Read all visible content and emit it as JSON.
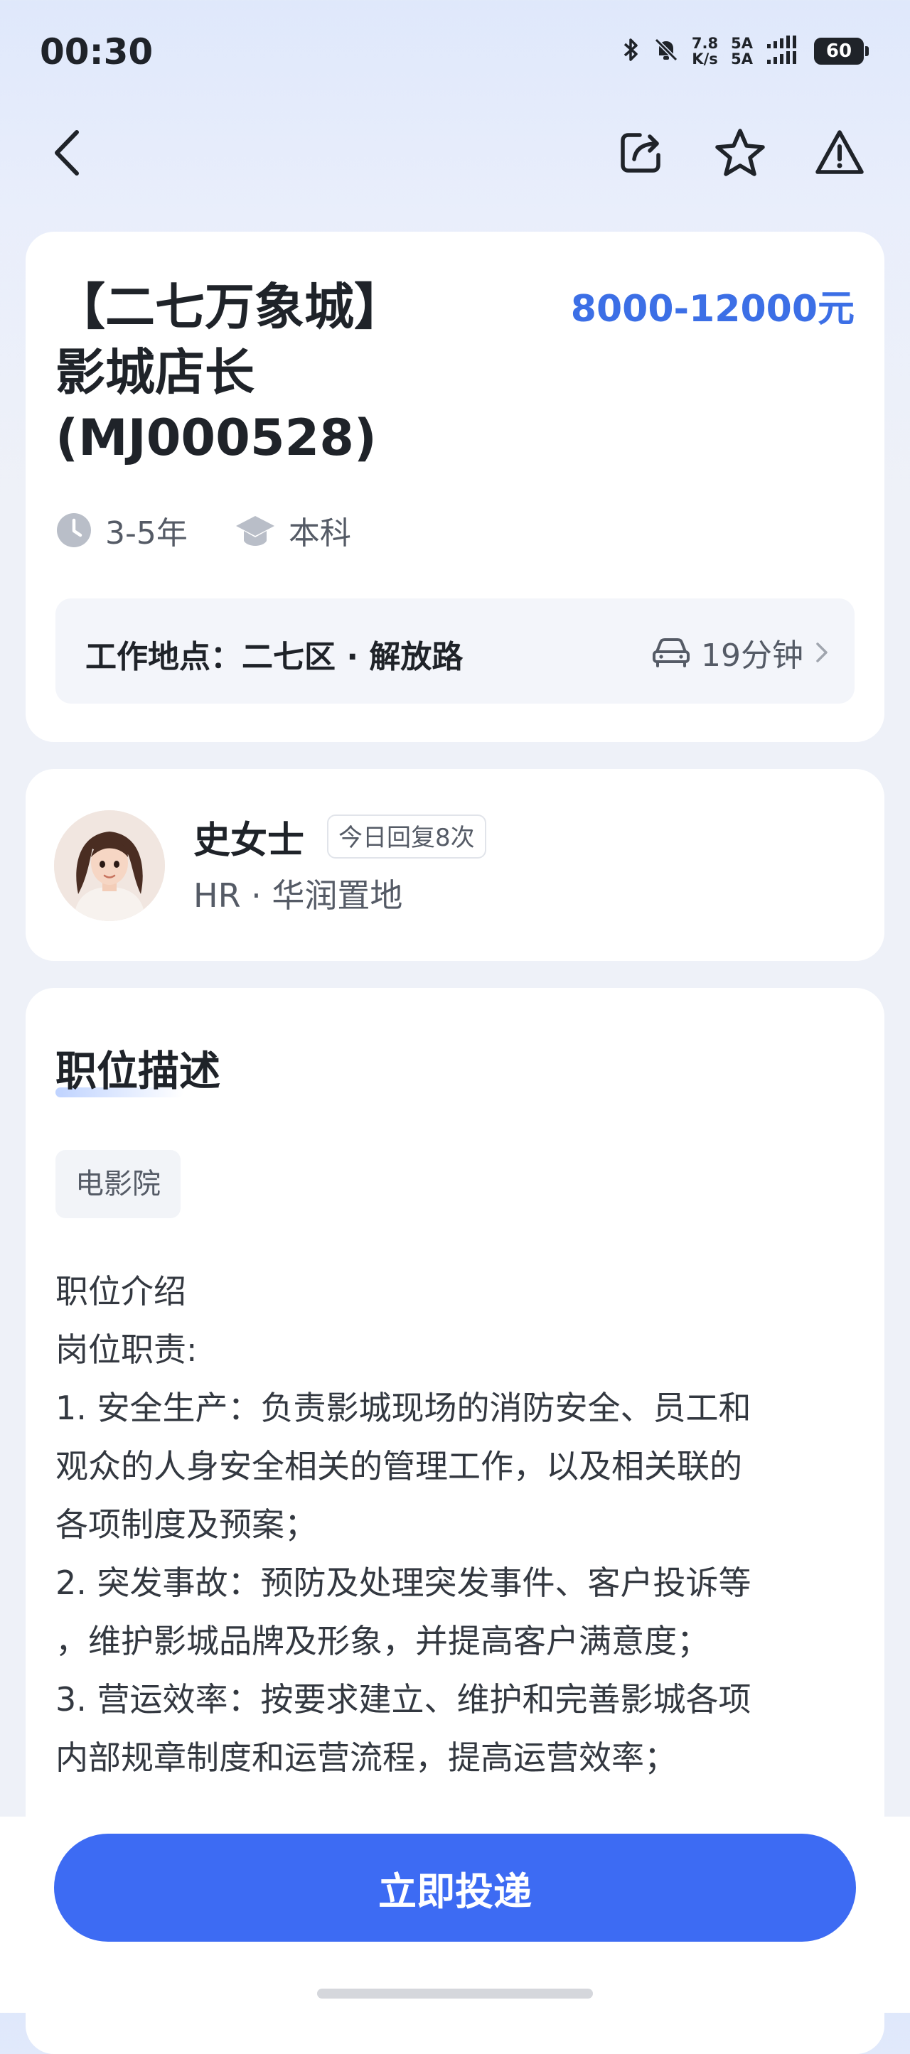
{
  "status_bar": {
    "time": "00:30",
    "net_speed_value": "7.8",
    "net_speed_unit": "K/s",
    "sim1": "5A",
    "sim2": "5A",
    "battery": "60"
  },
  "job": {
    "title_line1": "【二七万象城】",
    "title_line2": "影城店长",
    "title_line3": "(MJ000528)",
    "salary": "8000-12000元",
    "experience": "3-5年",
    "education": "本科",
    "location_label": "工作地点：二七区 · 解放路",
    "commute_time": "19分钟"
  },
  "hr": {
    "name": "史女士",
    "reply_badge": "今日回复8次",
    "company": "HR · 华润置地"
  },
  "description": {
    "section_title": "职位描述",
    "tag": "电影院",
    "lines": [
      "职位介绍",
      "岗位职责:",
      "1. 安全生产：负责影城现场的消防安全、员工和",
      "观众的人身安全相关的管理工作，以及相关联的",
      "各项制度及预案；",
      "2. 突发事故：预防及处理突发事件、客户投诉等",
      "，维护影城品牌及形象，并提高客户满意度；",
      "3. 营运效率：按要求建立、维护和完善影城各项",
      "内部规章制度和运营流程，提高运营效率；"
    ]
  },
  "actions": {
    "apply_label": "立即投递"
  },
  "colors": {
    "accent": "#3c6fe6",
    "button": "#3d6bf3"
  },
  "icons": [
    "back-icon",
    "share-icon",
    "star-icon",
    "report-icon",
    "clock-icon",
    "graduation-cap-icon",
    "car-icon",
    "chevron-right-icon",
    "bluetooth-icon",
    "mute-bell-icon"
  ]
}
